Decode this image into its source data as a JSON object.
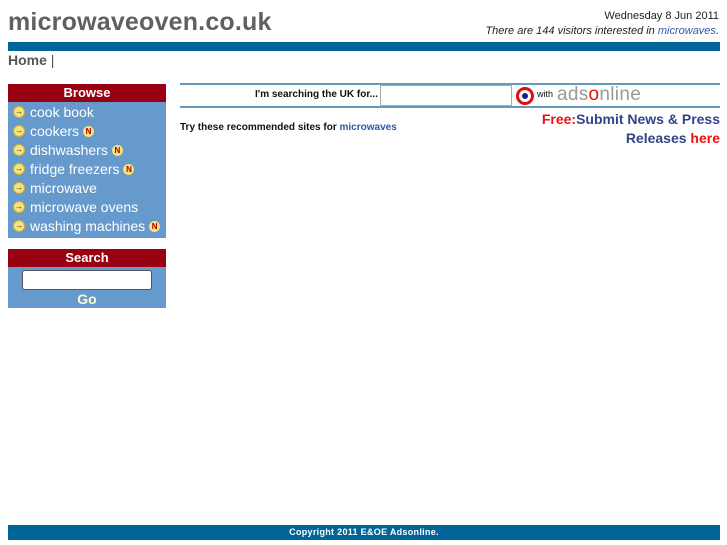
{
  "header": {
    "site_title": "microwaveoven.co.uk",
    "date": "Wednesday 8 Jun 2011",
    "visitors_prefix": "There are 144 visitors interested in ",
    "visitors_link": "microwaves",
    "visitors_suffix": "."
  },
  "nav": {
    "home": "Home",
    "separator": "|"
  },
  "browse": {
    "title": "Browse",
    "items": [
      {
        "label": "cook book",
        "new": false
      },
      {
        "label": "cookers",
        "new": true
      },
      {
        "label": "dishwashers",
        "new": true
      },
      {
        "label": "fridge freezers",
        "new": true
      },
      {
        "label": "microwave",
        "new": false
      },
      {
        "label": "microwave ovens",
        "new": false
      },
      {
        "label": "washing machines",
        "new": true
      }
    ],
    "new_badge": "N",
    "arrow_icon": "→"
  },
  "search": {
    "title": "Search",
    "input_value": "",
    "go_label": "Go"
  },
  "uk_search": {
    "label": "I'm searching the UK for...",
    "input_value": "",
    "with": "with",
    "brand_pre": "ads",
    "brand_o": "o",
    "brand_post": "nline"
  },
  "recommended": {
    "prefix": "Try these recommended sites for ",
    "link": "microwaves"
  },
  "press": {
    "free": "Free:",
    "text": "Submit News & Press Releases ",
    "here": "here"
  },
  "footer": {
    "copyright": "Copyright 2011 E&OE Adsonline."
  },
  "colors": {
    "header_bar": "#006699",
    "box_head": "#990011",
    "box_body": "#6699cc",
    "link": "#3355aa",
    "accent_red": "#ee1111"
  }
}
